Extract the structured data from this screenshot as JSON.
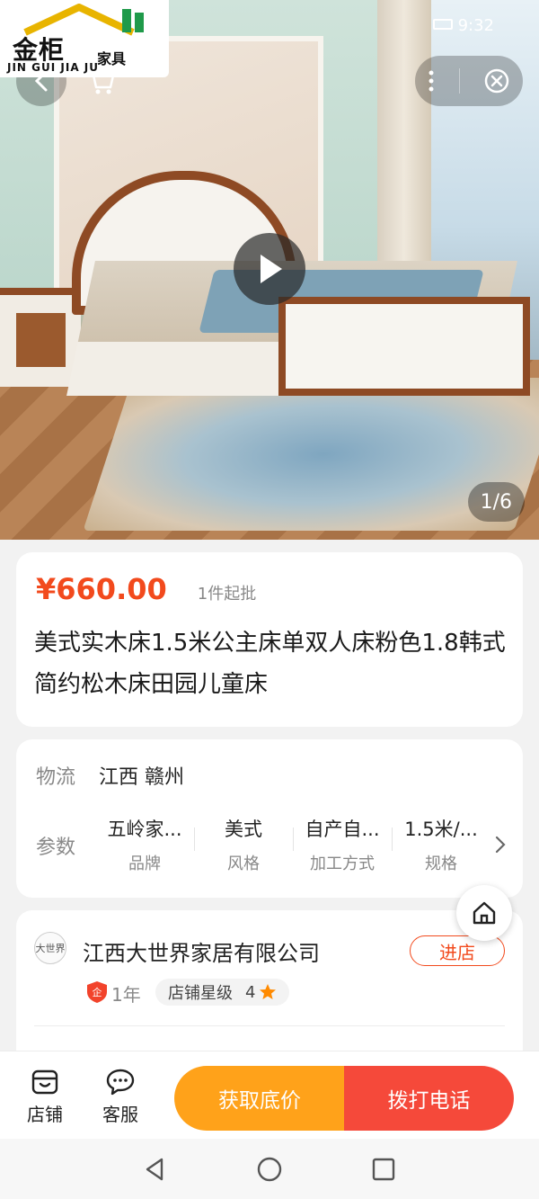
{
  "status": {
    "time": "9:32"
  },
  "logo": {
    "brand": "金柜",
    "brand_sub": "家具",
    "pinyin": "JIN GUI JIA JU"
  },
  "hero": {
    "counter": "1/6"
  },
  "product": {
    "price": "¥660.00",
    "moq": "1件起批",
    "title": "美式实木床1.5米公主床单双人床粉色1.8韩式简约松木床田园儿童床"
  },
  "specs": {
    "logistics_label": "物流",
    "logistics_value": "江西 赣州",
    "params_label": "参数",
    "params": [
      {
        "value": "五岭家...",
        "key": "品牌"
      },
      {
        "value": "美式",
        "key": "风格"
      },
      {
        "value": "自产自...",
        "key": "加工方式"
      },
      {
        "value": "1.5米/...",
        "key": "规格"
      }
    ]
  },
  "shop": {
    "name": "江西大世界家居有限公司",
    "enter_label": "进店",
    "years": "1年",
    "star_label": "店铺星级",
    "star_level": "4",
    "avatar_text": "大世界"
  },
  "bottombar": {
    "tab_shop": "店铺",
    "tab_service": "客服",
    "cta_price": "获取底价",
    "cta_call": "拨打电话"
  },
  "colors": {
    "accent": "#f24a1d",
    "cta_orange": "#ffa21a",
    "cta_red": "#f5493a"
  }
}
